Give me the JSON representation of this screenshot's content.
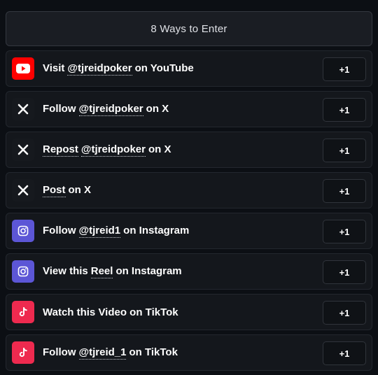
{
  "header": {
    "title": "8 Ways to Enter"
  },
  "entries": [
    {
      "icon": "youtube-icon",
      "color": "#ff0000",
      "prefix": "Visit",
      "link": "@tjreidpoker",
      "suffix": "on YouTube",
      "points": "+1"
    },
    {
      "icon": "x-icon",
      "color": "#16191e",
      "prefix": "Follow",
      "link": "@tjreidpoker",
      "suffix": "on X",
      "points": "+1"
    },
    {
      "icon": "x-icon",
      "color": "#16191e",
      "prefix": "Repost",
      "link": "@tjreidpoker",
      "suffix": "on X",
      "points": "+1"
    },
    {
      "icon": "x-icon",
      "color": "#16191e",
      "prefix": "",
      "link": "Post",
      "suffix": "on X",
      "points": "+1"
    },
    {
      "icon": "instagram-icon",
      "color": "#5c56d6",
      "prefix": "Follow",
      "link": "@tjreid1",
      "suffix": "on Instagram",
      "points": "+1"
    },
    {
      "icon": "instagram-icon",
      "color": "#5c56d6",
      "prefix": "View this",
      "link": "Reel",
      "suffix": "on Instagram",
      "points": "+1"
    },
    {
      "icon": "tiktok-icon",
      "color": "#ee2a4f",
      "prefix": "Watch this Video on TikTok",
      "link": "",
      "suffix": "",
      "points": "+1"
    },
    {
      "icon": "tiktok-icon",
      "color": "#ee2a4f",
      "prefix": "Follow",
      "link": "@tjreid_1",
      "suffix": "on TikTok",
      "points": "+1"
    }
  ]
}
